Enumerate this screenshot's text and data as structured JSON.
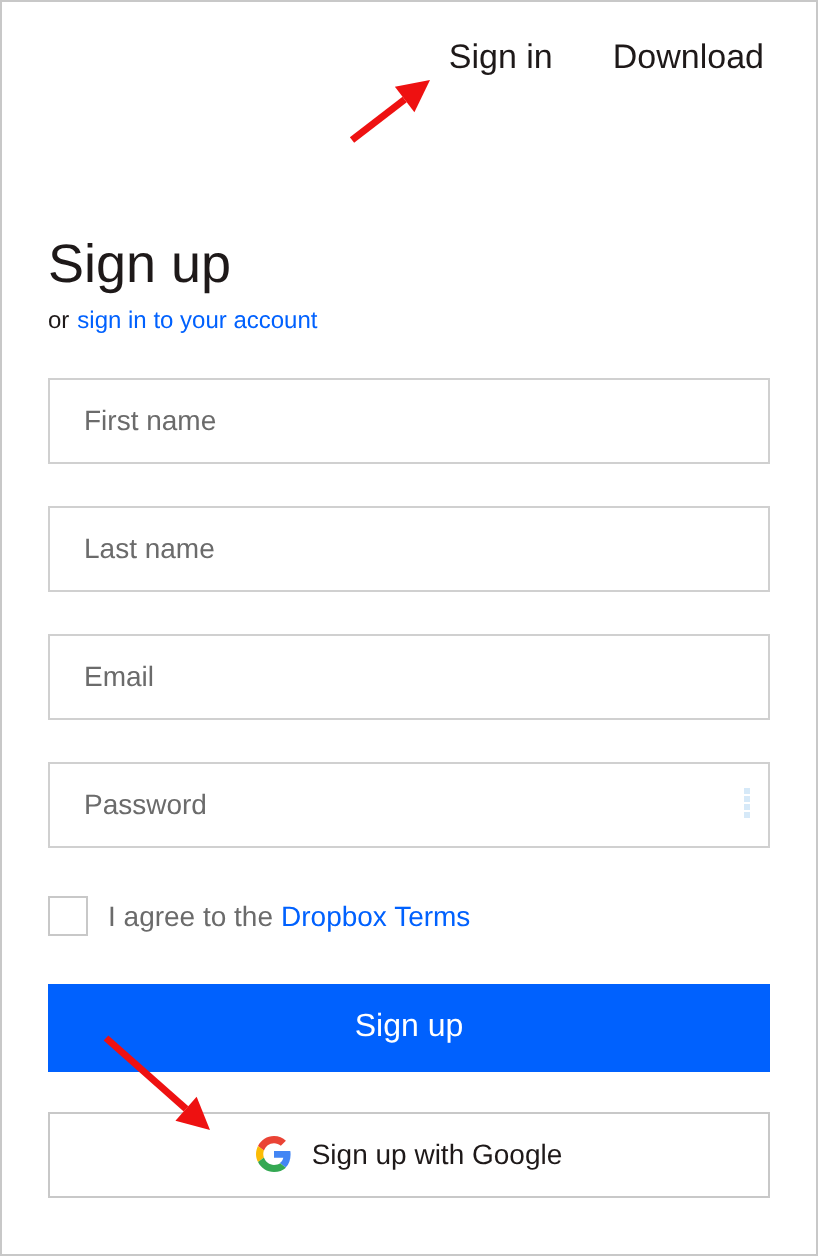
{
  "nav": [
    {
      "label": "Sign in"
    },
    {
      "label": "Download"
    }
  ],
  "title": "Sign up",
  "subtitle": {
    "prefix": "or",
    "link": "sign in to your account"
  },
  "fields": [
    {
      "placeholder": "First name",
      "kind": "text"
    },
    {
      "placeholder": "Last name",
      "kind": "text"
    },
    {
      "placeholder": "Email",
      "kind": "text"
    },
    {
      "placeholder": "Password",
      "kind": "password"
    }
  ],
  "terms": {
    "checked": false,
    "text": "I agree to the",
    "link": "Dropbox Terms"
  },
  "submit": "Sign up",
  "google_button": "Sign up with Google"
}
